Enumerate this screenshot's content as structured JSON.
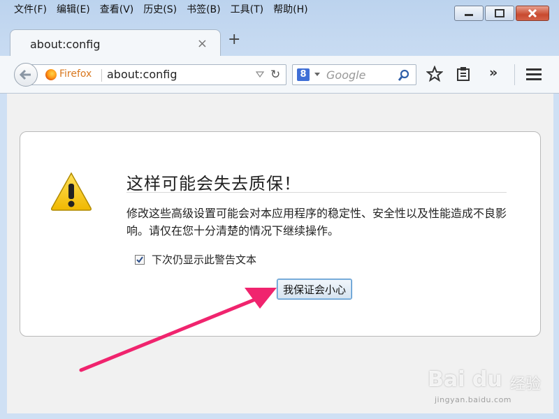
{
  "menubar": {
    "items": [
      "文件(F)",
      "编辑(E)",
      "查看(V)",
      "历史(S)",
      "书签(B)",
      "工具(T)",
      "帮助(H)"
    ]
  },
  "tab": {
    "title": "about:config",
    "close": "×",
    "new_tab": "+"
  },
  "navbar": {
    "identity": "Firefox",
    "url": "about:config",
    "search_placeholder": "Google",
    "search_engine_letter": "8",
    "overflow": "»"
  },
  "warning": {
    "title": "这样可能会失去质保！",
    "description": "修改这些高级设置可能会对本应用程序的稳定性、安全性以及性能造成不良影响。请仅在您十分清楚的情况下继续操作。",
    "checkbox_label": "下次仍显示此警告文本",
    "checkbox_checked": true,
    "accept_label": "我保证会小心"
  },
  "watermark": {
    "logo": "Bai du",
    "cn": "经验",
    "url": "jingyan.baidu.com"
  },
  "colors": {
    "annotation_arrow": "#f0246e",
    "accent": "#4f8ec7",
    "warning_yellow": "#f5c400"
  }
}
